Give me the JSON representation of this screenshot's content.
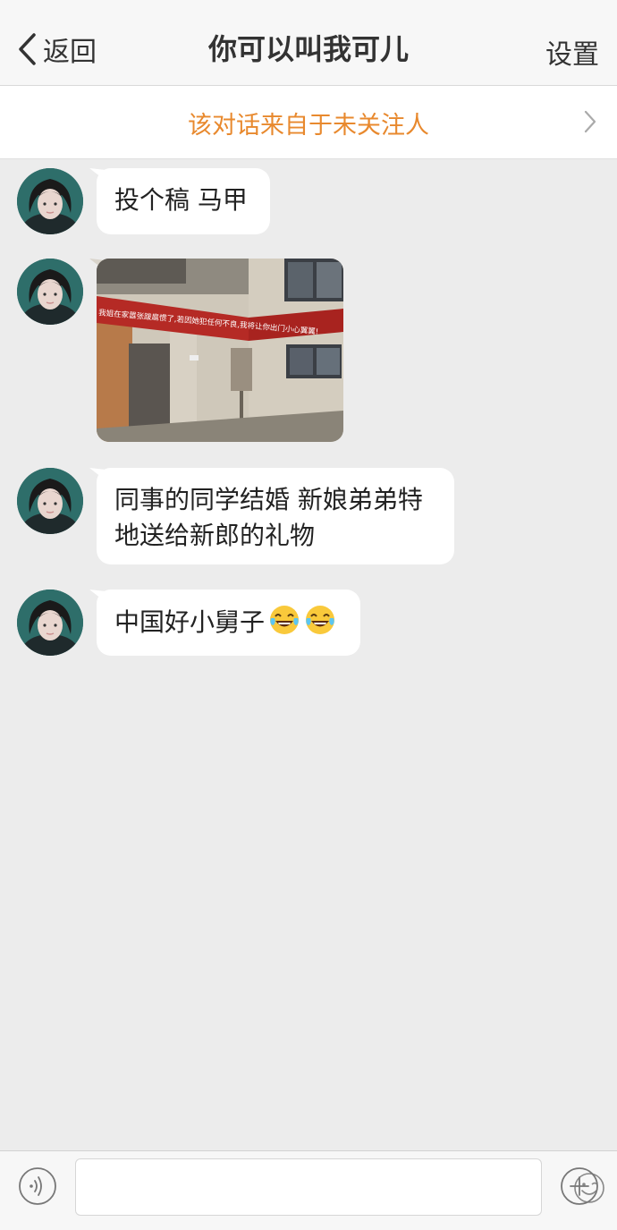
{
  "header": {
    "back_label": "返回",
    "title": "你可以叫我可儿",
    "settings_label": "设置"
  },
  "banner": {
    "text": "该对话来自于未关注人"
  },
  "messages": [
    {
      "type": "text",
      "text": "投个稿 马甲"
    },
    {
      "type": "image",
      "banner_text": "我姐在家嚣张跋扈惯了,若因她犯任何不良,我将让你出门小心翼翼!"
    },
    {
      "type": "text",
      "line1": "同事的同学结婚 新娘弟弟特",
      "line2": "地送给新郎的礼物"
    },
    {
      "type": "text",
      "text": "中国好小舅子",
      "emojis": [
        "tears-of-joy",
        "tears-of-joy"
      ]
    }
  ],
  "input": {
    "placeholder": "",
    "value": ""
  },
  "icons": [
    "chevron-left-icon",
    "chevron-right-icon",
    "voice-icon",
    "smile-icon",
    "plus-icon"
  ],
  "colors": {
    "accent_orange": "#e8892e",
    "background": "#ececec",
    "bubble": "#ffffff"
  }
}
